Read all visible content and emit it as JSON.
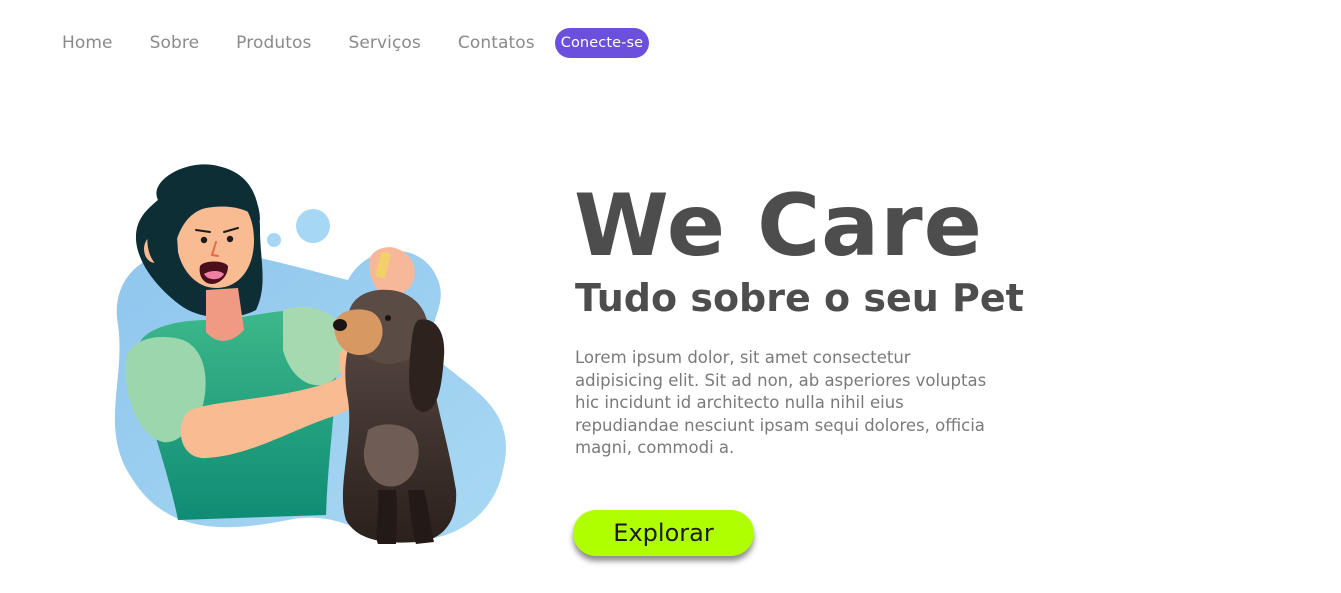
{
  "nav": {
    "items": [
      {
        "label": "Home"
      },
      {
        "label": "Sobre"
      },
      {
        "label": "Produtos"
      },
      {
        "label": "Serviços"
      },
      {
        "label": "Contatos"
      }
    ],
    "cta_label": "Conecte-se"
  },
  "hero": {
    "title": "We Care",
    "subtitle": "Tudo sobre o seu Pet",
    "text": "Lorem ipsum dolor, sit amet consectetur adipisicing elit. Sit ad non, ab asperiores voluptas hic incidunt id architecto nulla nihil eius repudiandae nesciunt ipsam sequi dolores, officia magni, commodi a.",
    "button_label": "Explorar"
  },
  "illustration": {
    "icon": "woman-giving-dog-ear-drops-illustration"
  },
  "colors": {
    "accent": "#6c4fdc",
    "button": "#b0ff00",
    "heading": "#4d4d4d",
    "body_text": "#7a7a7a",
    "nav_text": "#8a8a8a"
  }
}
